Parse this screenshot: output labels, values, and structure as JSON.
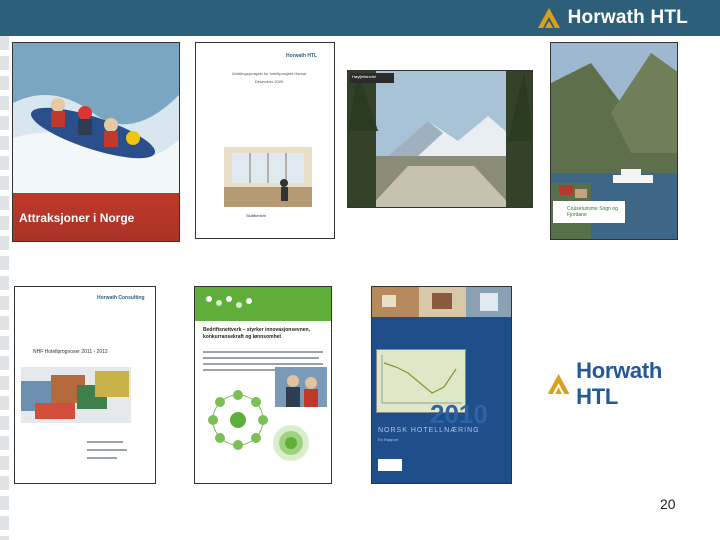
{
  "header": {
    "logo_text": "Horwath HTL",
    "bar_color": "#2e5f7a",
    "logo_icon": "horwath-mountain-icon"
  },
  "covers": {
    "attraksjoner": {
      "title": "Attraksjoner i Norge"
    },
    "utviklingsprosjekt": {
      "logo": "Horwath HTL",
      "title": "Utviklingsprosjekt for hotellprosjekt Hamar",
      "date": "Desember 2009",
      "label": "Sluttbericht"
    },
    "lodge": {
      "label": "Høyfjellshotel"
    },
    "fjord": {
      "label": "Cruiseturisme Sogn og Fjordane"
    },
    "consulting": {
      "logo": "Horwath Consulting",
      "title": "NHF Hotellprognoser 2011 - 2012"
    },
    "green": {
      "title": "Bedriftsnettverk – styrker innovasjonsevnen, konkurransekraft og lønnsomhet"
    },
    "hotel2010": {
      "year": "2010",
      "title": "NORSK HOTELLNÆRING",
      "subtitle": "En Rapport"
    }
  },
  "footer": {
    "logo_text": "Horwath HTL",
    "page_number": "20"
  }
}
